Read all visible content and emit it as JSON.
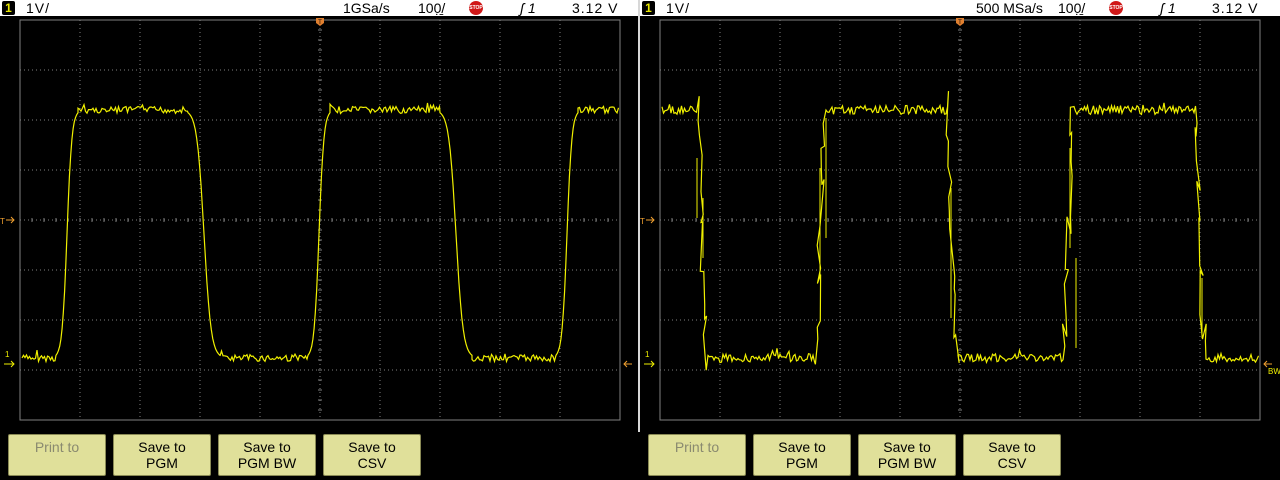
{
  "colors": {
    "trace": "#f0f000",
    "grid": "#808080",
    "background": "#000000",
    "softkey": "#e0e09a",
    "stop": "#d01818"
  },
  "panels": [
    {
      "channel": "1",
      "scale": "1V/",
      "sample_rate": "1GSa/s",
      "time_div": "100̣̱/",
      "stop_label": "STOP",
      "trigger": "ʃ 1",
      "trigger_level": "3.12  V",
      "ground_marker": "1",
      "trigger_marker": "T",
      "bw_label": "",
      "softkeys": [
        {
          "line1": "Print to",
          "line2": "",
          "enabled": false
        },
        {
          "line1": "Save to",
          "line2": "PGM",
          "enabled": true
        },
        {
          "line1": "Save to",
          "line2": "PGM BW",
          "enabled": true
        },
        {
          "line1": "Save to",
          "line2": "CSV",
          "enabled": true
        }
      ]
    },
    {
      "channel": "1",
      "scale": "1V/",
      "sample_rate": "500 MSa/s",
      "time_div": "100̣̱/",
      "stop_label": "STOP",
      "trigger": "ʃ 1",
      "trigger_level": "3.12  V",
      "ground_marker": "1",
      "trigger_marker": "T",
      "bw_label": "BW",
      "softkeys": [
        {
          "line1": "Print to",
          "line2": "",
          "enabled": false
        },
        {
          "line1": "Save to",
          "line2": "PGM",
          "enabled": true
        },
        {
          "line1": "Save to",
          "line2": "PGM BW",
          "enabled": true
        },
        {
          "line1": "Save to",
          "line2": "CSV",
          "enabled": true
        }
      ]
    }
  ],
  "icons": {
    "stop": "stop-sign-icon",
    "trigger": "rising-edge-trigger-icon",
    "ground": "ground-reference-arrow-icon"
  }
}
